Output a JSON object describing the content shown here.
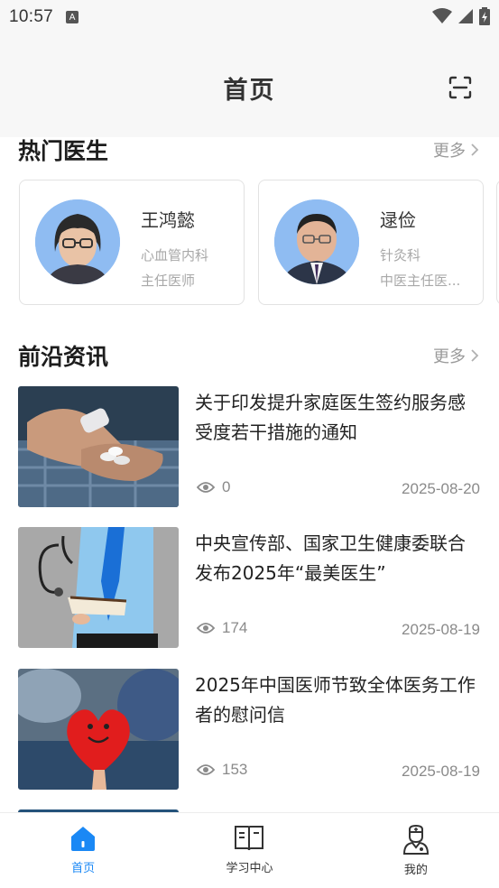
{
  "status_bar": {
    "time": "10:57",
    "notif_icon_letter": "A"
  },
  "header": {
    "title": "首页",
    "scan_icon": "scan-icon"
  },
  "hot_doctors": {
    "title": "热门医生",
    "more_label": "更多",
    "doctors": [
      {
        "name": "王鸿懿",
        "department": "心血管内科",
        "title": "主任医师"
      },
      {
        "name": "逯俭",
        "department": "针灸科",
        "title": "中医主任医..."
      }
    ]
  },
  "news": {
    "title": "前沿资讯",
    "more_label": "更多",
    "items": [
      {
        "title": "关于印发提升家庭医生签约服务感受度若干措施的通知",
        "views": "0",
        "date": "2025-08-20"
      },
      {
        "title": "中央宣传部、国家卫生健康委联合发布2025年“最美医生”",
        "views": "174",
        "date": "2025-08-19"
      },
      {
        "title": "2025年中国医师节致全体医务工作者的慰问信",
        "views": "153",
        "date": "2025-08-19"
      }
    ]
  },
  "bottom_nav": {
    "active_color": "#1a88f5",
    "items": [
      {
        "label": "首页",
        "icon": "home-icon",
        "active": true
      },
      {
        "label": "学习中心",
        "icon": "book-icon",
        "active": false
      },
      {
        "label": "我的",
        "icon": "doctor-profile-icon",
        "active": false
      }
    ]
  }
}
